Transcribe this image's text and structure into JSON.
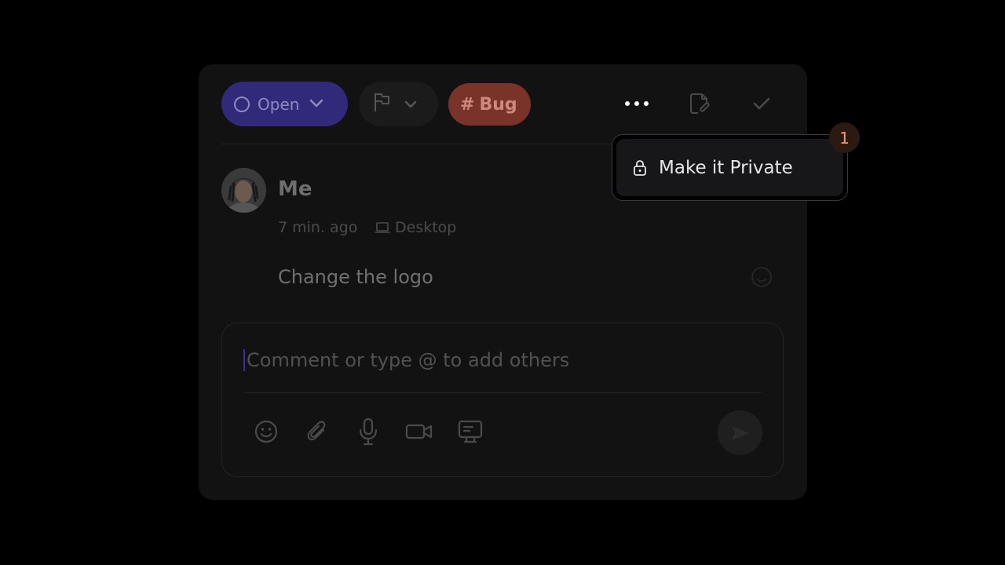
{
  "toolbar": {
    "status_label": "Open",
    "tag_hash": "#",
    "tag_label": "Bug"
  },
  "comment": {
    "author": "Me",
    "time": "7 min. ago",
    "device": "Desktop",
    "text": "Change the logo"
  },
  "composer": {
    "placeholder": "Comment or type @ to add others"
  },
  "menu": {
    "items": [
      {
        "label": "Make it Private",
        "icon": "lock-icon"
      }
    ]
  },
  "badge": {
    "count": "1"
  },
  "colors": {
    "status_chip": "#31297a",
    "tag_chip": "#7a3329",
    "badge_text": "#ff9a52"
  }
}
